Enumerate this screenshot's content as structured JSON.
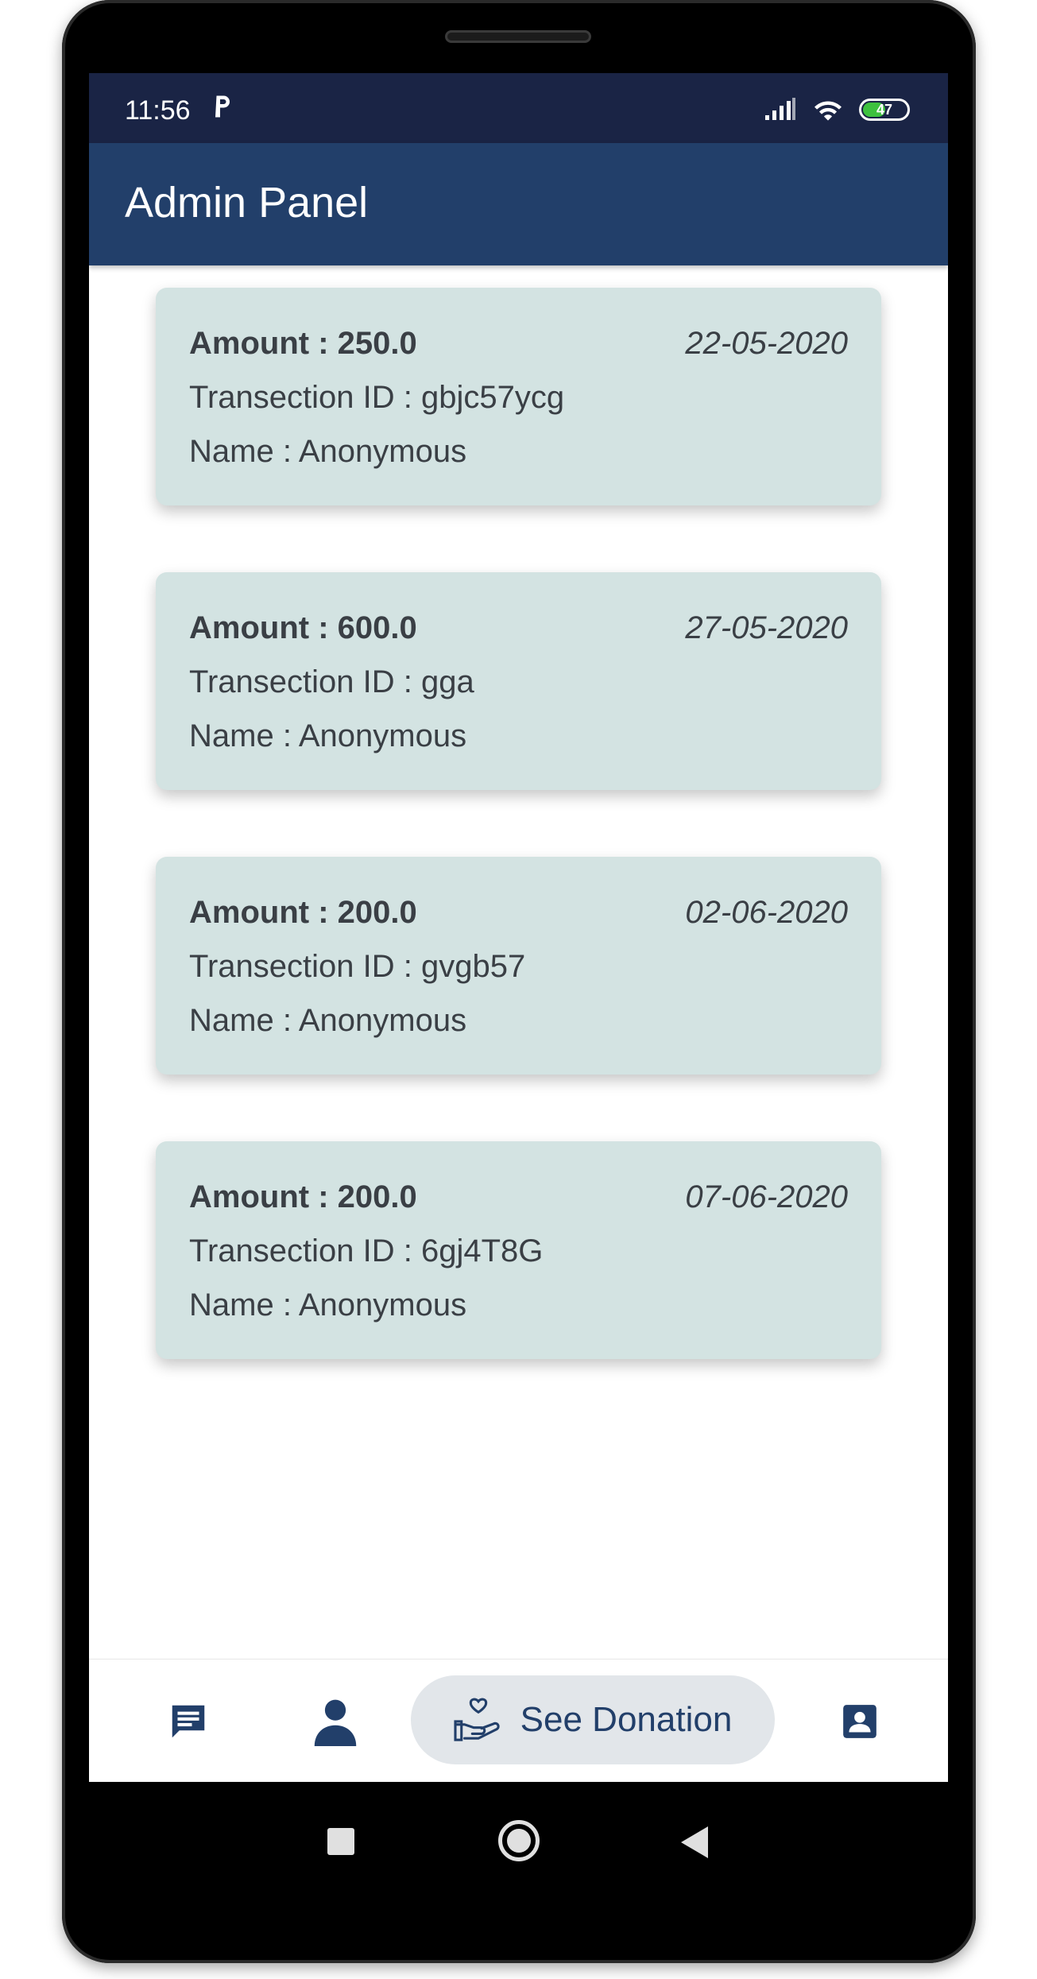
{
  "status_bar": {
    "time": "11:56",
    "battery": "47"
  },
  "app_bar": {
    "title": "Admin Panel"
  },
  "donations": [
    {
      "amount": "Amount : 250.0",
      "date": "22-05-2020",
      "transaction": "Transection ID : gbjc57ycg",
      "name": "Name : Anonymous"
    },
    {
      "amount": "Amount : 600.0",
      "date": "27-05-2020",
      "transaction": "Transection ID : gga",
      "name": "Name : Anonymous"
    },
    {
      "amount": "Amount : 200.0",
      "date": "02-06-2020",
      "transaction": "Transection ID : gvgb57",
      "name": "Name : Anonymous"
    },
    {
      "amount": "Amount : 200.0",
      "date": "07-06-2020",
      "transaction": "Transection ID : 6gj4T8G",
      "name": "Name : Anonymous"
    }
  ],
  "bottom_nav": {
    "items": [
      {
        "icon": "chat-icon"
      },
      {
        "icon": "person-icon"
      },
      {
        "icon": "donation-hand-heart-icon",
        "label": "See Donation",
        "selected": true
      },
      {
        "icon": "contact-card-icon"
      }
    ]
  },
  "colors": {
    "status_bar": "#1a2445",
    "app_bar": "#223f6a",
    "card": "#d3e3e2",
    "text": "#3a3f45",
    "nav_selected_bg": "#e2e6ea",
    "nav_icon": "#223f6a"
  }
}
